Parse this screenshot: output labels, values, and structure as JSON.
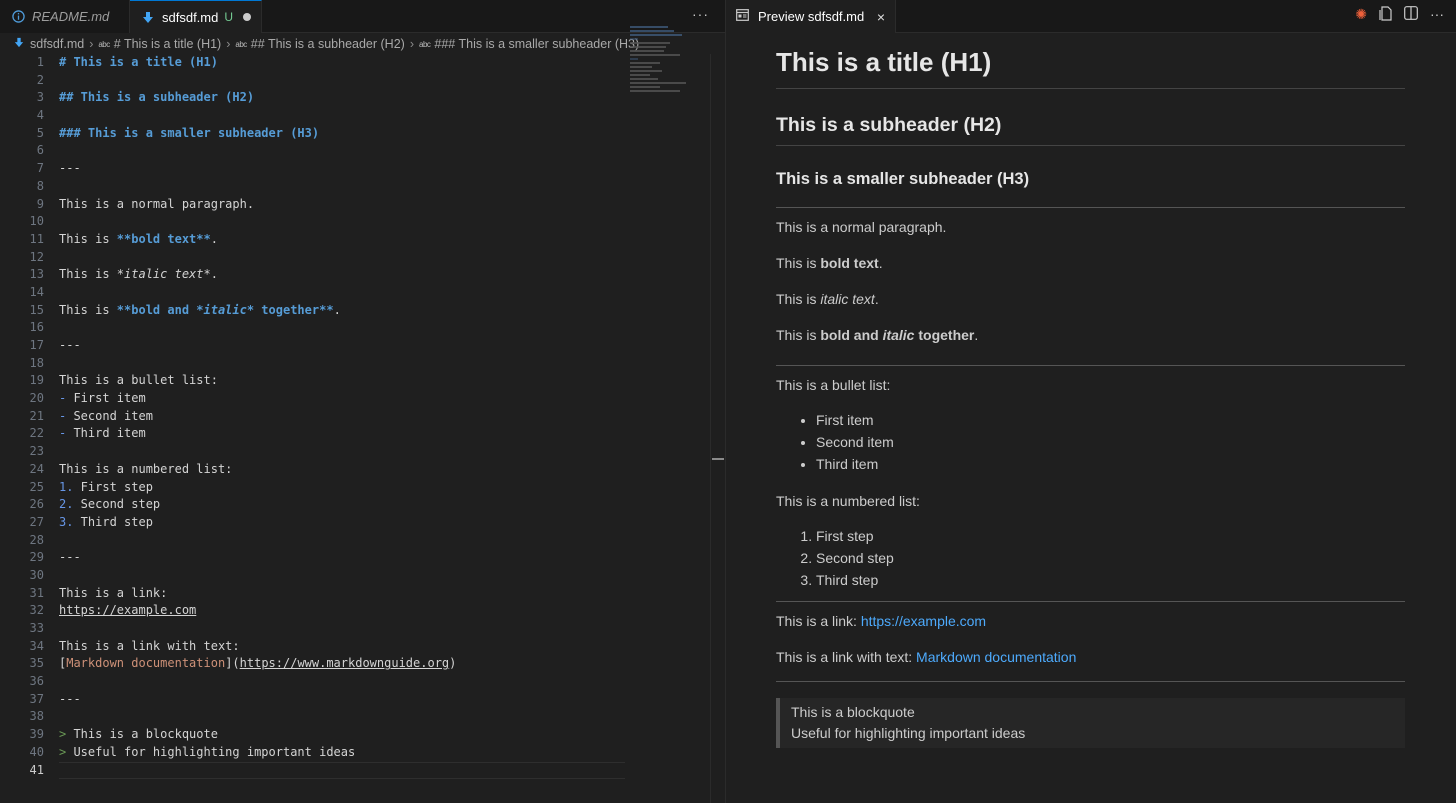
{
  "editor": {
    "tabs": [
      {
        "label": "README.md",
        "icon": "info-icon"
      },
      {
        "label": "sdfsdf.md",
        "status": "U",
        "icon": "markdown-icon"
      }
    ],
    "more_label": "···",
    "breadcrumb": {
      "file": "sdfsdf.md",
      "h1": "# This is a title (H1)",
      "h2": "## This is a subheader (H2)",
      "h3": "### This is a smaller subheader (H3)",
      "symbol_glyph": "abc"
    },
    "line_numbers": [
      "1",
      "2",
      "3",
      "4",
      "5",
      "6",
      "7",
      "8",
      "9",
      "10",
      "11",
      "12",
      "13",
      "14",
      "15",
      "16",
      "17",
      "18",
      "19",
      "20",
      "21",
      "22",
      "23",
      "24",
      "25",
      "26",
      "27",
      "28",
      "29",
      "30",
      "31",
      "32",
      "33",
      "34",
      "35",
      "36",
      "37",
      "38",
      "39",
      "40",
      "41"
    ],
    "code": {
      "l1": "# This is a title (H1)",
      "l3": "## This is a subheader (H2)",
      "l5": "### This is a smaller subheader (H3)",
      "hr": "---",
      "l9": "This is a normal paragraph.",
      "l11_pre": "This is ",
      "l11_bold": "**bold text**",
      "l11_post": ".",
      "l13_pre": "This is ",
      "l13_it": "*italic text*",
      "l13_post": ".",
      "l15_pre": "This is ",
      "l15_b1": "**bold and ",
      "l15_it": "*italic*",
      "l15_b2": " together**",
      "l15_post": ".",
      "l19": "This is a bullet list:",
      "dash": "-",
      "l20": " First item",
      "l21": " Second item",
      "l22": " Third item",
      "l24": "This is a numbered list:",
      "n1": "1.",
      "n2": "2.",
      "n3": "3.",
      "l25": " First step",
      "l26": " Second step",
      "l27": " Third step",
      "l31": "This is a link:",
      "l32": "https://example.com",
      "l34": "This is a link with text:",
      "l35_open": "[",
      "l35_text": "Markdown documentation",
      "l35_mid": "](",
      "l35_url": "https://www.markdownguide.org",
      "l35_close": ")",
      "gt": ">",
      "l39": " This is a blockquote",
      "l40": " Useful for highlighting important ideas"
    }
  },
  "preview": {
    "tab_label": "Preview sdfsdf.md",
    "close_glyph": "×",
    "h1": "This is a title (H1)",
    "h2": "This is a subheader (H2)",
    "h3": "This is a smaller subheader (H3)",
    "para": "This is a normal paragraph.",
    "bold_pre": "This is ",
    "bold_text": "bold text",
    "bold_post": ".",
    "italic_pre": "This is ",
    "italic_text": "italic text",
    "italic_post": ".",
    "bi_pre": "This is ",
    "bi_bold1": "bold and ",
    "bi_italic": "italic",
    "bi_bold2": " together",
    "bi_post": ".",
    "bullet_intro": "This is a bullet list:",
    "bullets": [
      "First item",
      "Second item",
      "Third item"
    ],
    "numbered_intro": "This is a numbered list:",
    "steps": [
      "First step",
      "Second step",
      "Third step"
    ],
    "link_pre": "This is a link: ",
    "link": "https://example.com",
    "link_text_pre": "This is a link with text: ",
    "link_text": "Markdown documentation",
    "quote": [
      "This is a blockquote",
      "Useful for highlighting important ideas"
    ]
  },
  "colors": {
    "accent": "#0078d4",
    "heading_blue": "#569cd6",
    "link_blue": "#4daafc",
    "untracked_green": "#73c991"
  }
}
